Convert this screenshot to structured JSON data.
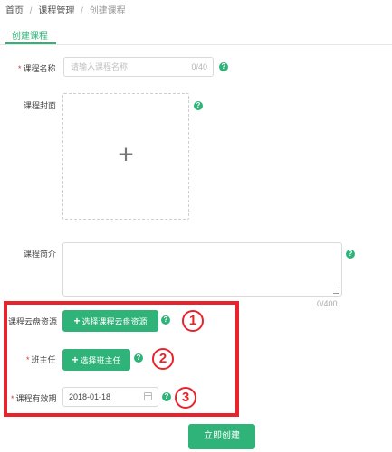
{
  "breadcrumb": {
    "home": "首页",
    "section": "课程管理",
    "current": "创建课程",
    "separator": "/"
  },
  "tab": {
    "label": "创建课程"
  },
  "form": {
    "course_name": {
      "label": "课程名称",
      "required_mark": "*",
      "placeholder": "请输入课程名称",
      "counter": "0/40"
    },
    "cover": {
      "label": "课程封面",
      "upload_glyph": "+"
    },
    "intro": {
      "label": "课程简介",
      "counter": "0/400"
    },
    "cloud": {
      "label": "课程云盘资源",
      "button_icon": "+",
      "button_label": "选择课程云盘资源"
    },
    "teacher": {
      "label": "班主任",
      "required_mark": "*",
      "button_icon": "+",
      "button_label": "选择班主任"
    },
    "validity": {
      "label": "课程有效期",
      "required_mark": "*",
      "value": "2018-01-18"
    },
    "help_glyph": "?",
    "submit_label": "立即创建"
  },
  "annotations": {
    "one": "1",
    "two": "2",
    "three": "3"
  },
  "colors": {
    "accent": "#2fb378",
    "required": "#e0302d",
    "highlight": "#e8232c"
  }
}
